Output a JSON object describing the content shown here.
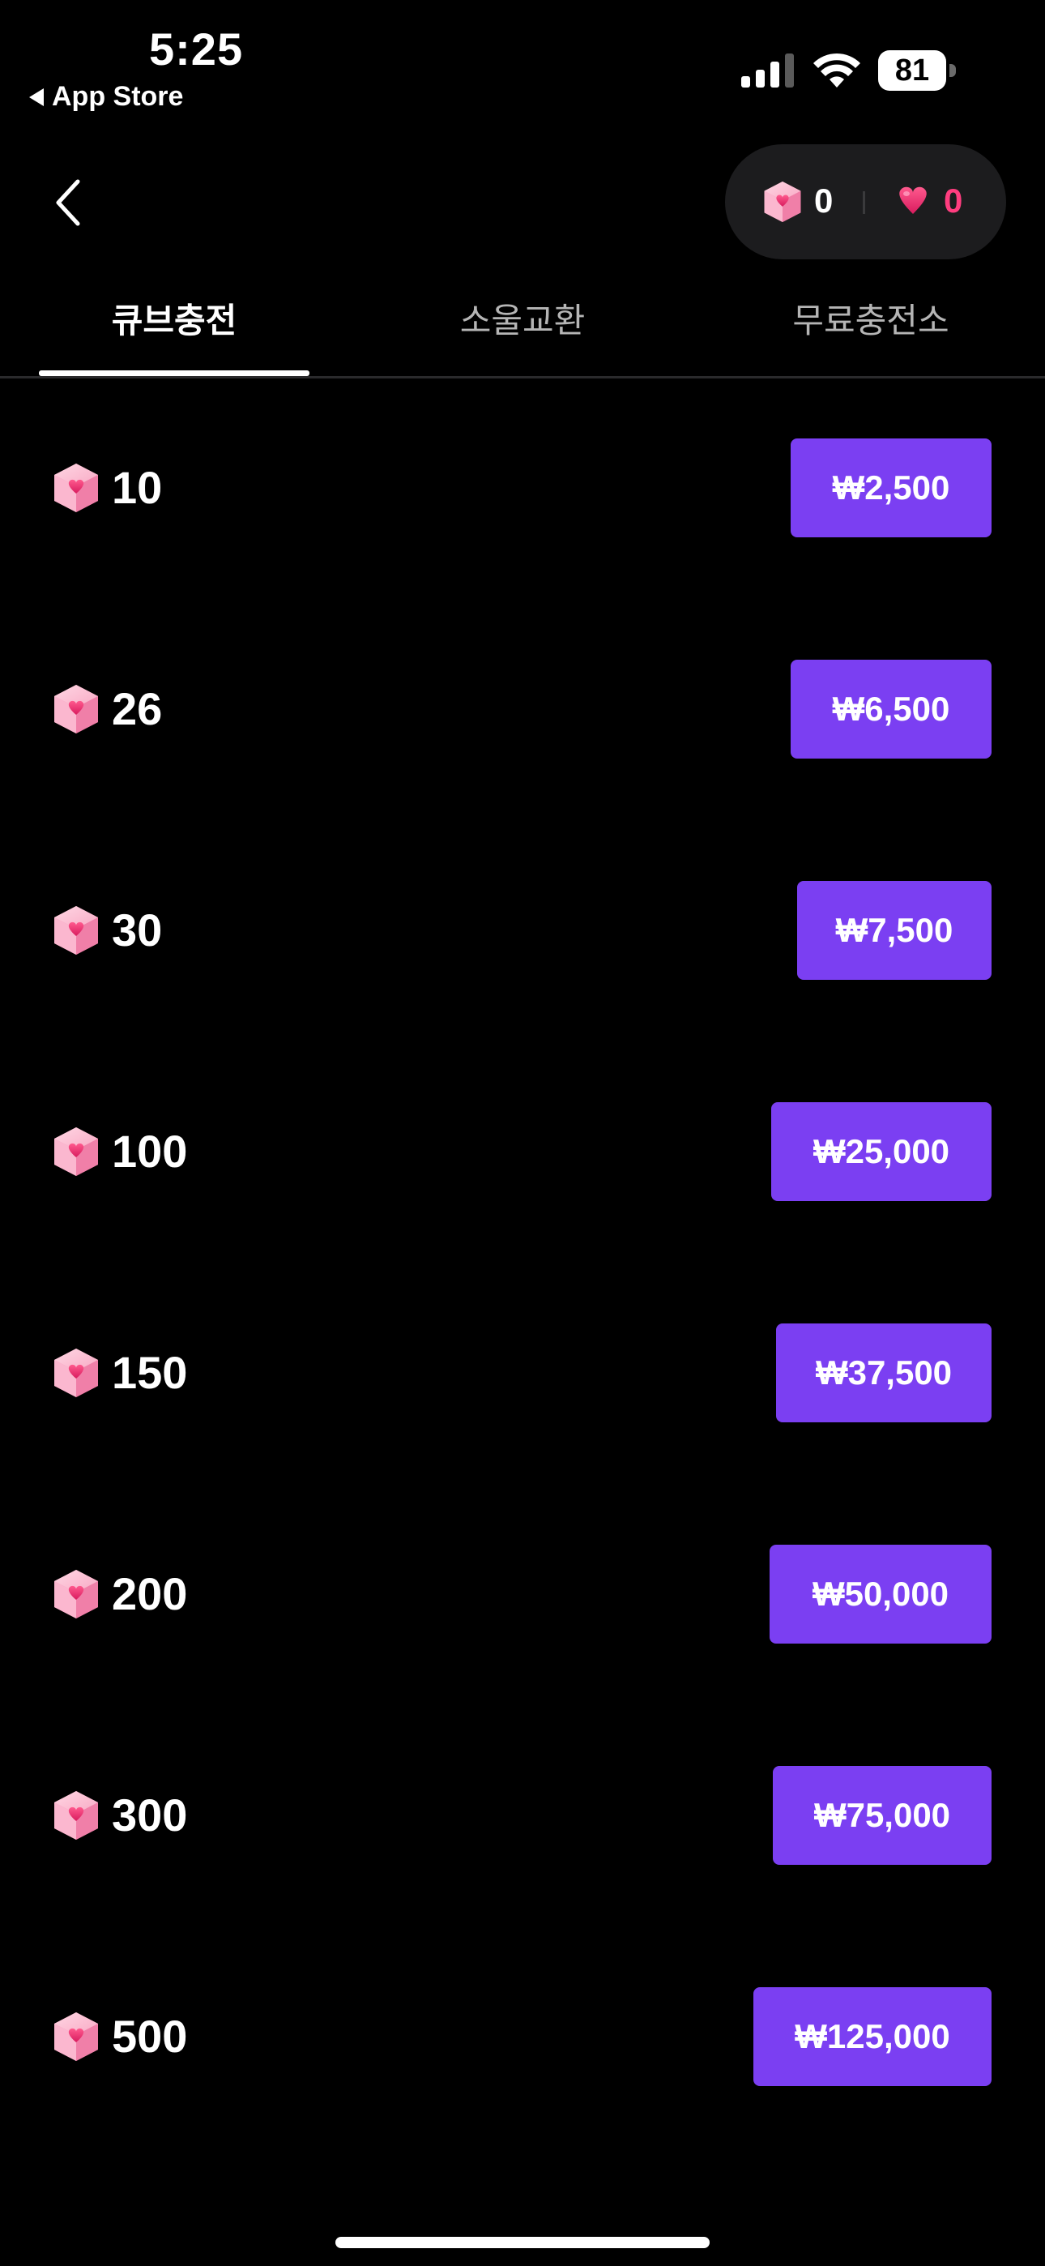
{
  "status_bar": {
    "time": "5:25",
    "back_label": "App Store",
    "battery": "81",
    "icons": [
      "cellular-signal-icon",
      "wifi-icon",
      "battery-icon"
    ]
  },
  "header": {
    "back_icon": "chevron-left-icon",
    "cube_balance": "0",
    "heart_balance": "0"
  },
  "tabs": [
    {
      "label": "큐브충전",
      "active": true
    },
    {
      "label": "소울교환",
      "active": false
    },
    {
      "label": "무료충전소",
      "active": false
    }
  ],
  "products": [
    {
      "amount": "10",
      "price": "₩2,500"
    },
    {
      "amount": "26",
      "price": "₩6,500"
    },
    {
      "amount": "30",
      "price": "₩7,500"
    },
    {
      "amount": "100",
      "price": "₩25,000"
    },
    {
      "amount": "150",
      "price": "₩37,500"
    },
    {
      "amount": "200",
      "price": "₩50,000"
    },
    {
      "amount": "300",
      "price": "₩75,000"
    },
    {
      "amount": "500",
      "price": "₩125,000"
    }
  ],
  "colors": {
    "background": "#000000",
    "accent": "#7b3ff2",
    "heart": "#ff3d7f",
    "pill": "#1c1c1e"
  }
}
